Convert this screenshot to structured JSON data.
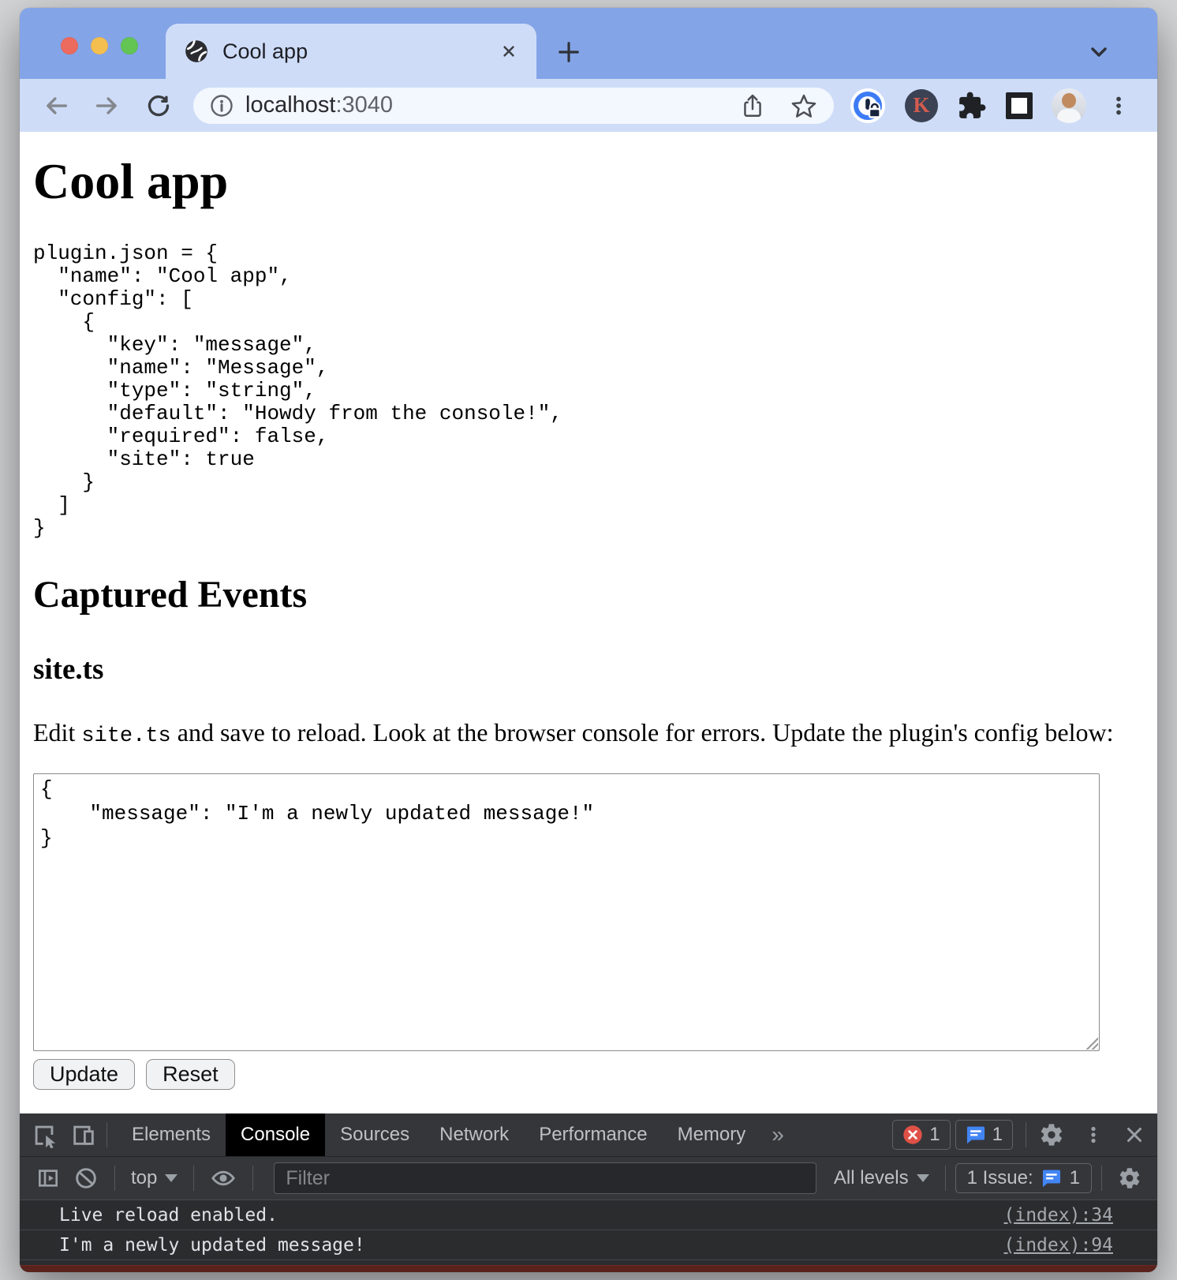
{
  "browser": {
    "tab_title": "Cool app",
    "url_host": "localhost",
    "url_port": ":3040"
  },
  "page": {
    "title": "Cool app",
    "code_block": "plugin.json = {\n  \"name\": \"Cool app\",\n  \"config\": [\n    {\n      \"key\": \"message\",\n      \"name\": \"Message\",\n      \"type\": \"string\",\n      \"default\": \"Howdy from the console!\",\n      \"required\": false,\n      \"site\": true\n    }\n  ]\n}",
    "heading_events": "Captured Events",
    "heading_site": "site.ts",
    "para_before": "Edit ",
    "para_code": "site.ts",
    "para_after": " and save to reload. Look at the browser console for errors. Update the plugin's config below:",
    "textarea_value": "{\n    \"message\": \"I'm a newly updated message!\"\n}",
    "update_label": "Update",
    "reset_label": "Reset"
  },
  "devtools": {
    "tabs": [
      "Elements",
      "Console",
      "Sources",
      "Network",
      "Performance",
      "Memory"
    ],
    "selected_tab": "Console",
    "more_tabs": "»",
    "error_count": "1",
    "message_count": "1",
    "toolbar": {
      "context": "top",
      "filter_placeholder": "Filter",
      "levels": "All levels",
      "issue_label": "1 Issue:",
      "issue_count": "1"
    },
    "console_messages": [
      {
        "text": "Live reload enabled.",
        "source": "(index):34"
      },
      {
        "text": "I'm a newly updated message!",
        "source": "(index):94"
      }
    ]
  },
  "colors": {
    "frame_blue": "#84a4e8",
    "toolbar_blue": "#cedcf8",
    "devtools_bar": "#35363a",
    "console_bg": "#2b2c2e",
    "error_red": "#df5146",
    "issue_blue": "#4285f4",
    "error_row_red": "#5a221c"
  }
}
